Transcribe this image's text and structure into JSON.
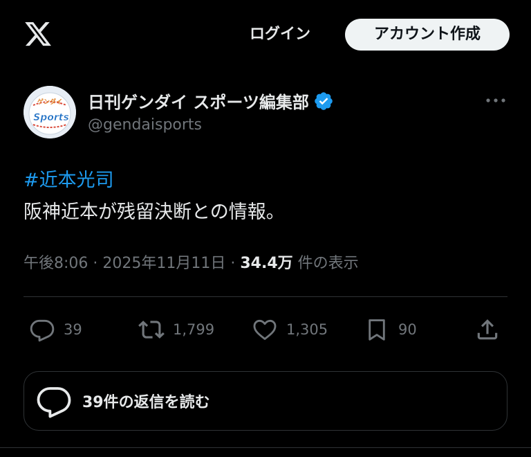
{
  "header": {
    "login_label": "ログイン",
    "signup_label": "アカウント作成"
  },
  "author": {
    "name": "日刊ゲンダイ スポーツ編集部",
    "handle": "@gendaisports",
    "verified": true,
    "avatar_text": "Sports"
  },
  "tweet": {
    "hashtag": "#近本光司",
    "text": "阪神近本が残留決断との情報。",
    "time": "午後8:06 · 2025年11月11日",
    "separator": " · ",
    "views": "34.4万",
    "views_suffix": " 件の表示"
  },
  "actions": {
    "replies": "39",
    "reposts": "1,799",
    "likes": "1,305",
    "bookmarks": "90"
  },
  "read_replies_label": "39件の返信を読む",
  "colors": {
    "background": "#000000",
    "text_primary": "#e7e9ea",
    "text_secondary": "#71767b",
    "accent": "#1d9bf0",
    "divider": "#2f3336"
  },
  "icons": [
    "x-logo-icon",
    "verified-badge-icon",
    "more-icon",
    "reply-icon",
    "repost-icon",
    "like-icon",
    "bookmark-icon",
    "share-icon",
    "replies-bubble-icon"
  ]
}
